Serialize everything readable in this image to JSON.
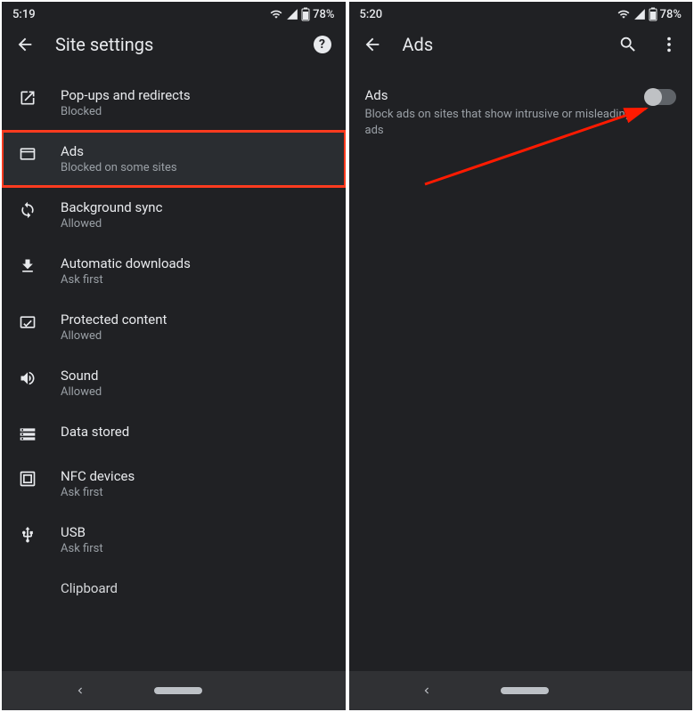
{
  "left": {
    "status": {
      "time": "5:19",
      "battery": "78%"
    },
    "title": "Site settings",
    "items": [
      {
        "label": "Pop-ups and redirects",
        "sub": "Blocked"
      },
      {
        "label": "Ads",
        "sub": "Blocked on some sites"
      },
      {
        "label": "Background sync",
        "sub": "Allowed"
      },
      {
        "label": "Automatic downloads",
        "sub": "Ask first"
      },
      {
        "label": "Protected content",
        "sub": "Allowed"
      },
      {
        "label": "Sound",
        "sub": "Allowed"
      },
      {
        "label": "Data stored",
        "sub": ""
      },
      {
        "label": "NFC devices",
        "sub": "Ask first"
      },
      {
        "label": "USB",
        "sub": "Ask first"
      },
      {
        "label": "Clipboard",
        "sub": ""
      }
    ]
  },
  "right": {
    "status": {
      "time": "5:20",
      "battery": "78%"
    },
    "title": "Ads",
    "setting": {
      "title": "Ads",
      "desc": "Block ads on sites that show intrusive or misleading ads"
    }
  }
}
